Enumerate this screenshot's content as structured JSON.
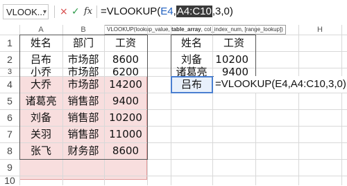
{
  "name_box": {
    "value": "VLOOK..."
  },
  "formula_bar": {
    "cancel_icon": "×",
    "confirm_icon": "✓",
    "fx_label": "fx",
    "formula_parts": [
      "=VLOOKUP(",
      "E4",
      ",",
      "A4:C10",
      ",3,0)"
    ]
  },
  "tooltip": {
    "prefix": "VLOOKUP(lookup_value, ",
    "bold": "table_array",
    "suffix": ", col_index_num, [range_lookup])"
  },
  "columns": [
    "A",
    "B",
    "C",
    "D",
    "E",
    "F",
    "G",
    "H"
  ],
  "rows": [
    "1",
    "2",
    "3",
    "4",
    "5",
    "6",
    "7",
    "8",
    "9",
    "10"
  ],
  "table1": {
    "headers": [
      "姓名",
      "部门",
      "工资"
    ],
    "rows": [
      [
        "吕布",
        "市场部",
        "8600"
      ],
      [
        "小乔",
        "市场部",
        "6200"
      ],
      [
        "大乔",
        "市场部",
        "14200"
      ],
      [
        "诸葛亮",
        "销售部",
        "9400"
      ],
      [
        "刘备",
        "销售部",
        "10200"
      ],
      [
        "关羽",
        "销售部",
        "11000"
      ],
      [
        "张飞",
        "财务部",
        "8600"
      ]
    ]
  },
  "table2": {
    "headers": [
      "姓名",
      "工资"
    ],
    "rows": [
      [
        "刘备",
        "10200"
      ],
      [
        "诸葛亮",
        "9400"
      ]
    ]
  },
  "active_cell": {
    "name": "吕布",
    "formula": "=VLOOKUP(E4,A4:C10,3,0)"
  },
  "colors": {
    "range_highlight": "#f8dede",
    "ref_blue": "#1f5fbf",
    "cancel_red": "#d64545",
    "confirm_green": "#2f9b4b"
  }
}
